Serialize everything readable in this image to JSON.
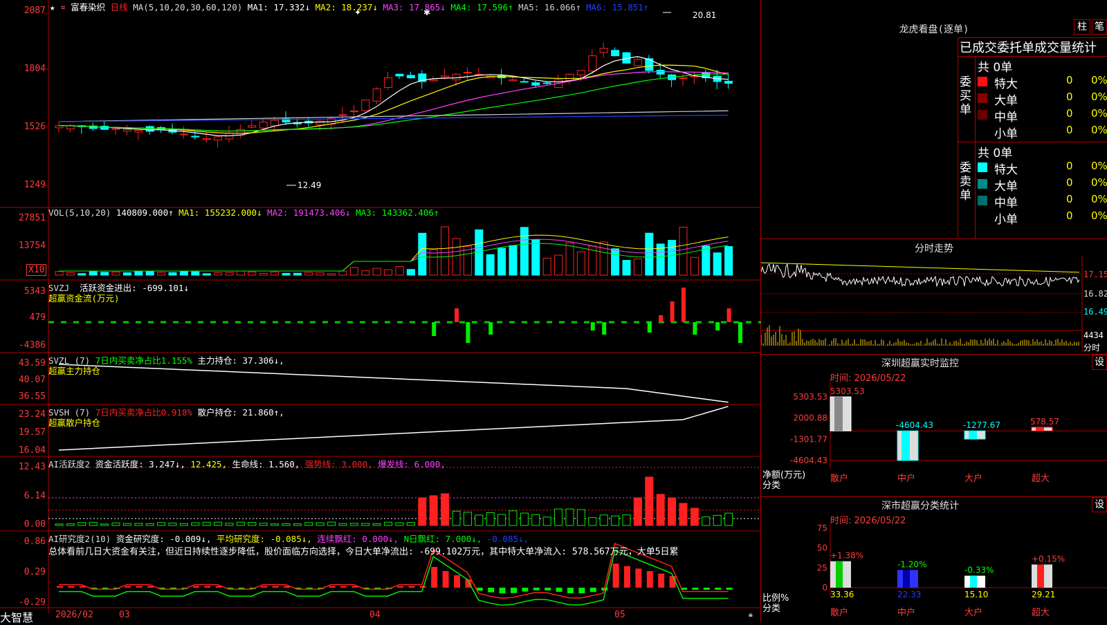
{
  "stock": {
    "name": "富春染织",
    "period": "日线"
  },
  "main": {
    "ma_params": "MA(5,10,20,30,60,120)",
    "ma1": "MA1: 17.332↓",
    "ma2": "MA2: 18.237↓",
    "ma3": "MA3: 17.865↓",
    "ma4": "MA4: 17.596↑",
    "ma5": "MA5: 16.066↑",
    "ma6": "MA6: 15.851↑",
    "y_ticks": [
      "2087",
      "1804",
      "1526",
      "1249"
    ],
    "high_marker": "20.81",
    "low_marker": "12.49"
  },
  "vol": {
    "label": "VOL(5,10,20)",
    "value": "140809.000↑",
    "ma1": "MA1: 155232.000↓",
    "ma2": "MA2: 191473.406↓",
    "ma3": "MA3: 143362.406↑",
    "y_ticks": [
      "27851",
      "13754"
    ],
    "unit": "X10"
  },
  "svzj": {
    "label": "SVZJ",
    "title": "活跃资金进出: -699.101↓",
    "subtitle": "超赢资金流(万元)",
    "y_ticks": [
      "5343",
      "479",
      "-4386"
    ]
  },
  "svzl": {
    "label": "SVZL (7)",
    "ratio": "7日内买卖净占比1.155%",
    "hold": "主力持仓: 37.306↓,",
    "subtitle": "超赢主力持仓",
    "y_ticks": [
      "43.59",
      "40.07",
      "36.55"
    ]
  },
  "svsh": {
    "label": "SVSH (7)",
    "ratio": "7日内买卖净占比0.918%",
    "hold": "散户持仓: 21.860↑,",
    "subtitle": "超赢散户持仓",
    "y_ticks": [
      "23.24",
      "19.57",
      "16.04"
    ]
  },
  "ai2": {
    "label": "AI活跃度2",
    "v1": "资金活跃度: 3.247↓,",
    "v2": "12.425,",
    "v3": "生命线: 1.560,",
    "v4": "强势线: 3.000,",
    "v5": "爆发线: 6.000,",
    "y_ticks": [
      "12.43",
      "6.14",
      "0.00"
    ]
  },
  "ai_research": {
    "label": "AI研究度2(10)",
    "v1": "资金研究度: -0.009↓,",
    "v2": "平均研究度: -0.085↓,",
    "v3": "连续飘红: 0.000↓,",
    "v4": "N日飘红: 7.000↓,",
    "v5": "-0.085↓,",
    "summary": "总体看前几日大资金有关注，但近日持续性逐步降低，股价面临方向选择，今日大单净流出: -699.102万元，其中特大单净流入: 578.567万元，大单5日累",
    "y_ticks": [
      "0.86",
      "0.29",
      "-0.29"
    ]
  },
  "xaxis": {
    "brand": "大智慧",
    "labels": [
      "2026/02",
      "03",
      "04",
      "05"
    ]
  },
  "dragon": {
    "title": "龙虎看盘(逐单)",
    "btn1": "柱",
    "btn2": "笔",
    "header": "已成交委托单成交量统计",
    "buy": {
      "side": "委买单",
      "total": "共 0单",
      "rows": [
        {
          "name": "特大",
          "count": "0",
          "pct": "0%",
          "color": "#ff1010"
        },
        {
          "name": "大单",
          "count": "0",
          "pct": "0%",
          "color": "#8a0000"
        },
        {
          "name": "中单",
          "count": "0",
          "pct": "0%",
          "color": "#6a0000"
        },
        {
          "name": "小单",
          "count": "0",
          "pct": "0%",
          "color": "#000000"
        }
      ]
    },
    "sell": {
      "side": "委卖单",
      "total": "共 0单",
      "rows": [
        {
          "name": "特大",
          "count": "0",
          "pct": "0%",
          "color": "#00ffff"
        },
        {
          "name": "大单",
          "count": "0",
          "pct": "0%",
          "color": "#008a8a"
        },
        {
          "name": "中单",
          "count": "0",
          "pct": "0%",
          "color": "#006e6e"
        },
        {
          "name": "小单",
          "count": "0",
          "pct": "0%",
          "color": "#000000"
        }
      ]
    }
  },
  "intraday": {
    "title": "分时走势",
    "prices": [
      "17.15",
      "16.82",
      "16.49"
    ],
    "vol_max": "4434",
    "vol_unit": "分时"
  },
  "monitor": {
    "title": "深圳超赢实时监控",
    "btn": "设",
    "time": "时间: 2026/05/22",
    "y_ticks": [
      "5303.53",
      "2000.88",
      "-1301.77",
      "-4604.43"
    ],
    "axis_label1": "净额(万元)",
    "axis_label2": "分类",
    "categories": [
      "散户",
      "中户",
      "大户",
      "超大"
    ],
    "values": [
      5303.53,
      -4604.43,
      -1277.67,
      578.57
    ],
    "value_labels": [
      "5303.53",
      "-4604.43",
      "-1277.67",
      "578.57"
    ]
  },
  "classify": {
    "title": "深市超赢分类统计",
    "btn": "设",
    "time": "时间: 2026/05/22",
    "y_ticks": [
      "75",
      "50",
      "25",
      "0"
    ],
    "axis_label1": "比例%",
    "axis_label2": "分类",
    "categories": [
      "散户",
      "中户",
      "大户",
      "超大"
    ],
    "values": [
      33.36,
      22.33,
      15.1,
      29.21
    ],
    "changes": [
      "+1.38%",
      "-1.20%",
      "-0.33%",
      "+0.15%"
    ],
    "value_labels": [
      "33.36",
      "22.33",
      "15.10",
      "29.21"
    ]
  }
}
